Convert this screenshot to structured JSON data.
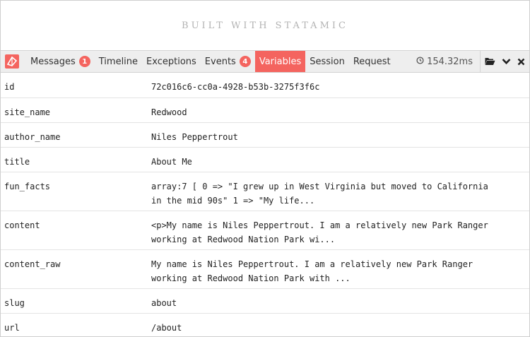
{
  "banner": {
    "text": "BUILT WITH STATAMIC"
  },
  "debugbar": {
    "tabs": [
      {
        "label": "Messages",
        "badge": "1"
      },
      {
        "label": "Timeline"
      },
      {
        "label": "Exceptions"
      },
      {
        "label": "Events",
        "badge": "4"
      },
      {
        "label": "Variables",
        "active": true
      },
      {
        "label": "Session"
      },
      {
        "label": "Request"
      }
    ],
    "time": "154.32ms",
    "accent_color": "#f4645f"
  },
  "variables": [
    {
      "key": "id",
      "value": "72c016c6-cc0a-4928-b53b-3275f3f6c"
    },
    {
      "key": "site_name",
      "value": "Redwood"
    },
    {
      "key": "author_name",
      "value": "Niles Peppertrout"
    },
    {
      "key": "title",
      "value": "About Me"
    },
    {
      "key": "fun_facts",
      "value": "array:7 [ 0 => \"I grew up in West Virginia but moved to California\nin the mid 90s\" 1 => \"My life..."
    },
    {
      "key": "content",
      "value": "<p>My name is Niles Peppertrout. I am a relatively new Park Ranger\nworking at Redwood Nation Park wi..."
    },
    {
      "key": "content_raw",
      "value": "My name is Niles Peppertrout. I am a relatively new Park Ranger\nworking at Redwood Nation Park with ..."
    },
    {
      "key": "slug",
      "value": "about"
    },
    {
      "key": "url",
      "value": "/about"
    }
  ]
}
